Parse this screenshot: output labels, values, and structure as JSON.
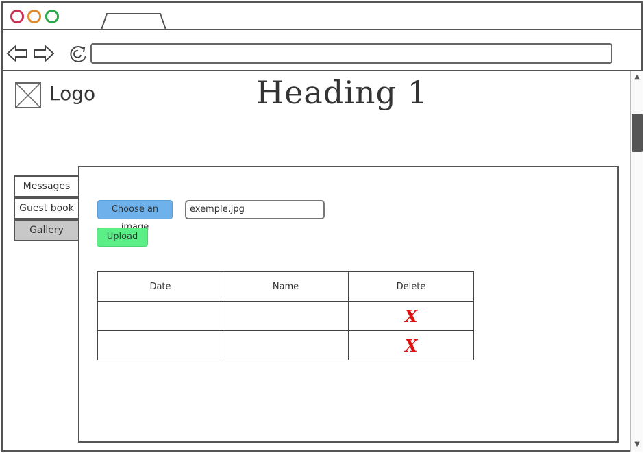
{
  "browser": {
    "window_controls": [
      "close",
      "minimize",
      "maximize"
    ],
    "url": ""
  },
  "page": {
    "logo_text": "Logo",
    "heading": "Heading 1"
  },
  "sidebar": {
    "tabs": [
      {
        "label": "Messages",
        "active": false
      },
      {
        "label": "Guest book",
        "active": false
      },
      {
        "label": "Gallery",
        "active": true
      }
    ]
  },
  "upload": {
    "choose_label": "Choose an image",
    "filename": "exemple.jpg",
    "upload_label": "Upload"
  },
  "table": {
    "columns": [
      "Date",
      "Name",
      "Delete"
    ],
    "rows": [
      {
        "date": "",
        "name": "",
        "delete": "X"
      },
      {
        "date": "",
        "name": "",
        "delete": "X"
      }
    ]
  },
  "colors": {
    "choose_button": "#6fb1ea",
    "upload_button": "#5cef88",
    "delete_icon": "#e01010",
    "active_tab": "#c8c8c8"
  }
}
